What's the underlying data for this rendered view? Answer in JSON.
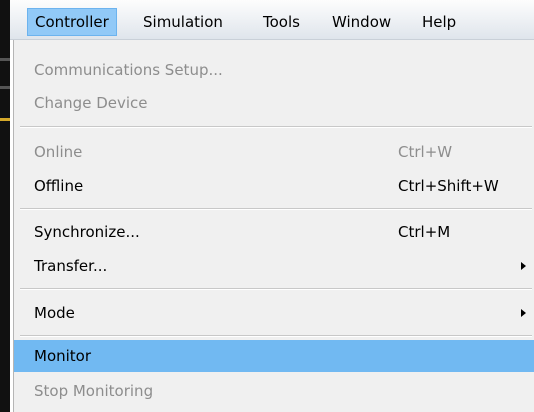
{
  "menubar": {
    "items": [
      {
        "label": "Controller",
        "active": true
      },
      {
        "label": "Simulation"
      },
      {
        "label": "Tools"
      },
      {
        "label": "Window"
      },
      {
        "label": "Help"
      }
    ]
  },
  "dropdown": {
    "items": [
      {
        "label": "Communications Setup...",
        "shortcut": "",
        "enabled": false
      },
      {
        "label": "Change Device",
        "shortcut": "",
        "enabled": false
      },
      {
        "label": "Online",
        "shortcut": "Ctrl+W",
        "enabled": false
      },
      {
        "label": "Offline",
        "shortcut": "Ctrl+Shift+W",
        "enabled": true
      },
      {
        "label": "Synchronize...",
        "shortcut": "Ctrl+M",
        "enabled": true
      },
      {
        "label": "Transfer...",
        "shortcut": "",
        "enabled": true,
        "submenu": true
      },
      {
        "label": "Mode",
        "shortcut": "",
        "enabled": true,
        "submenu": true
      },
      {
        "label": "Monitor",
        "shortcut": "",
        "enabled": true,
        "highlighted": true
      },
      {
        "label": "Stop Monitoring",
        "shortcut": "",
        "enabled": false
      }
    ]
  },
  "colors": {
    "menubar_active": "#91c9f7",
    "item_highlight": "#71b9f2",
    "disabled_text": "#8d8d8d",
    "menu_background": "#f0f0f0"
  },
  "icons": {
    "submenu": "submenu-arrow-icon"
  }
}
